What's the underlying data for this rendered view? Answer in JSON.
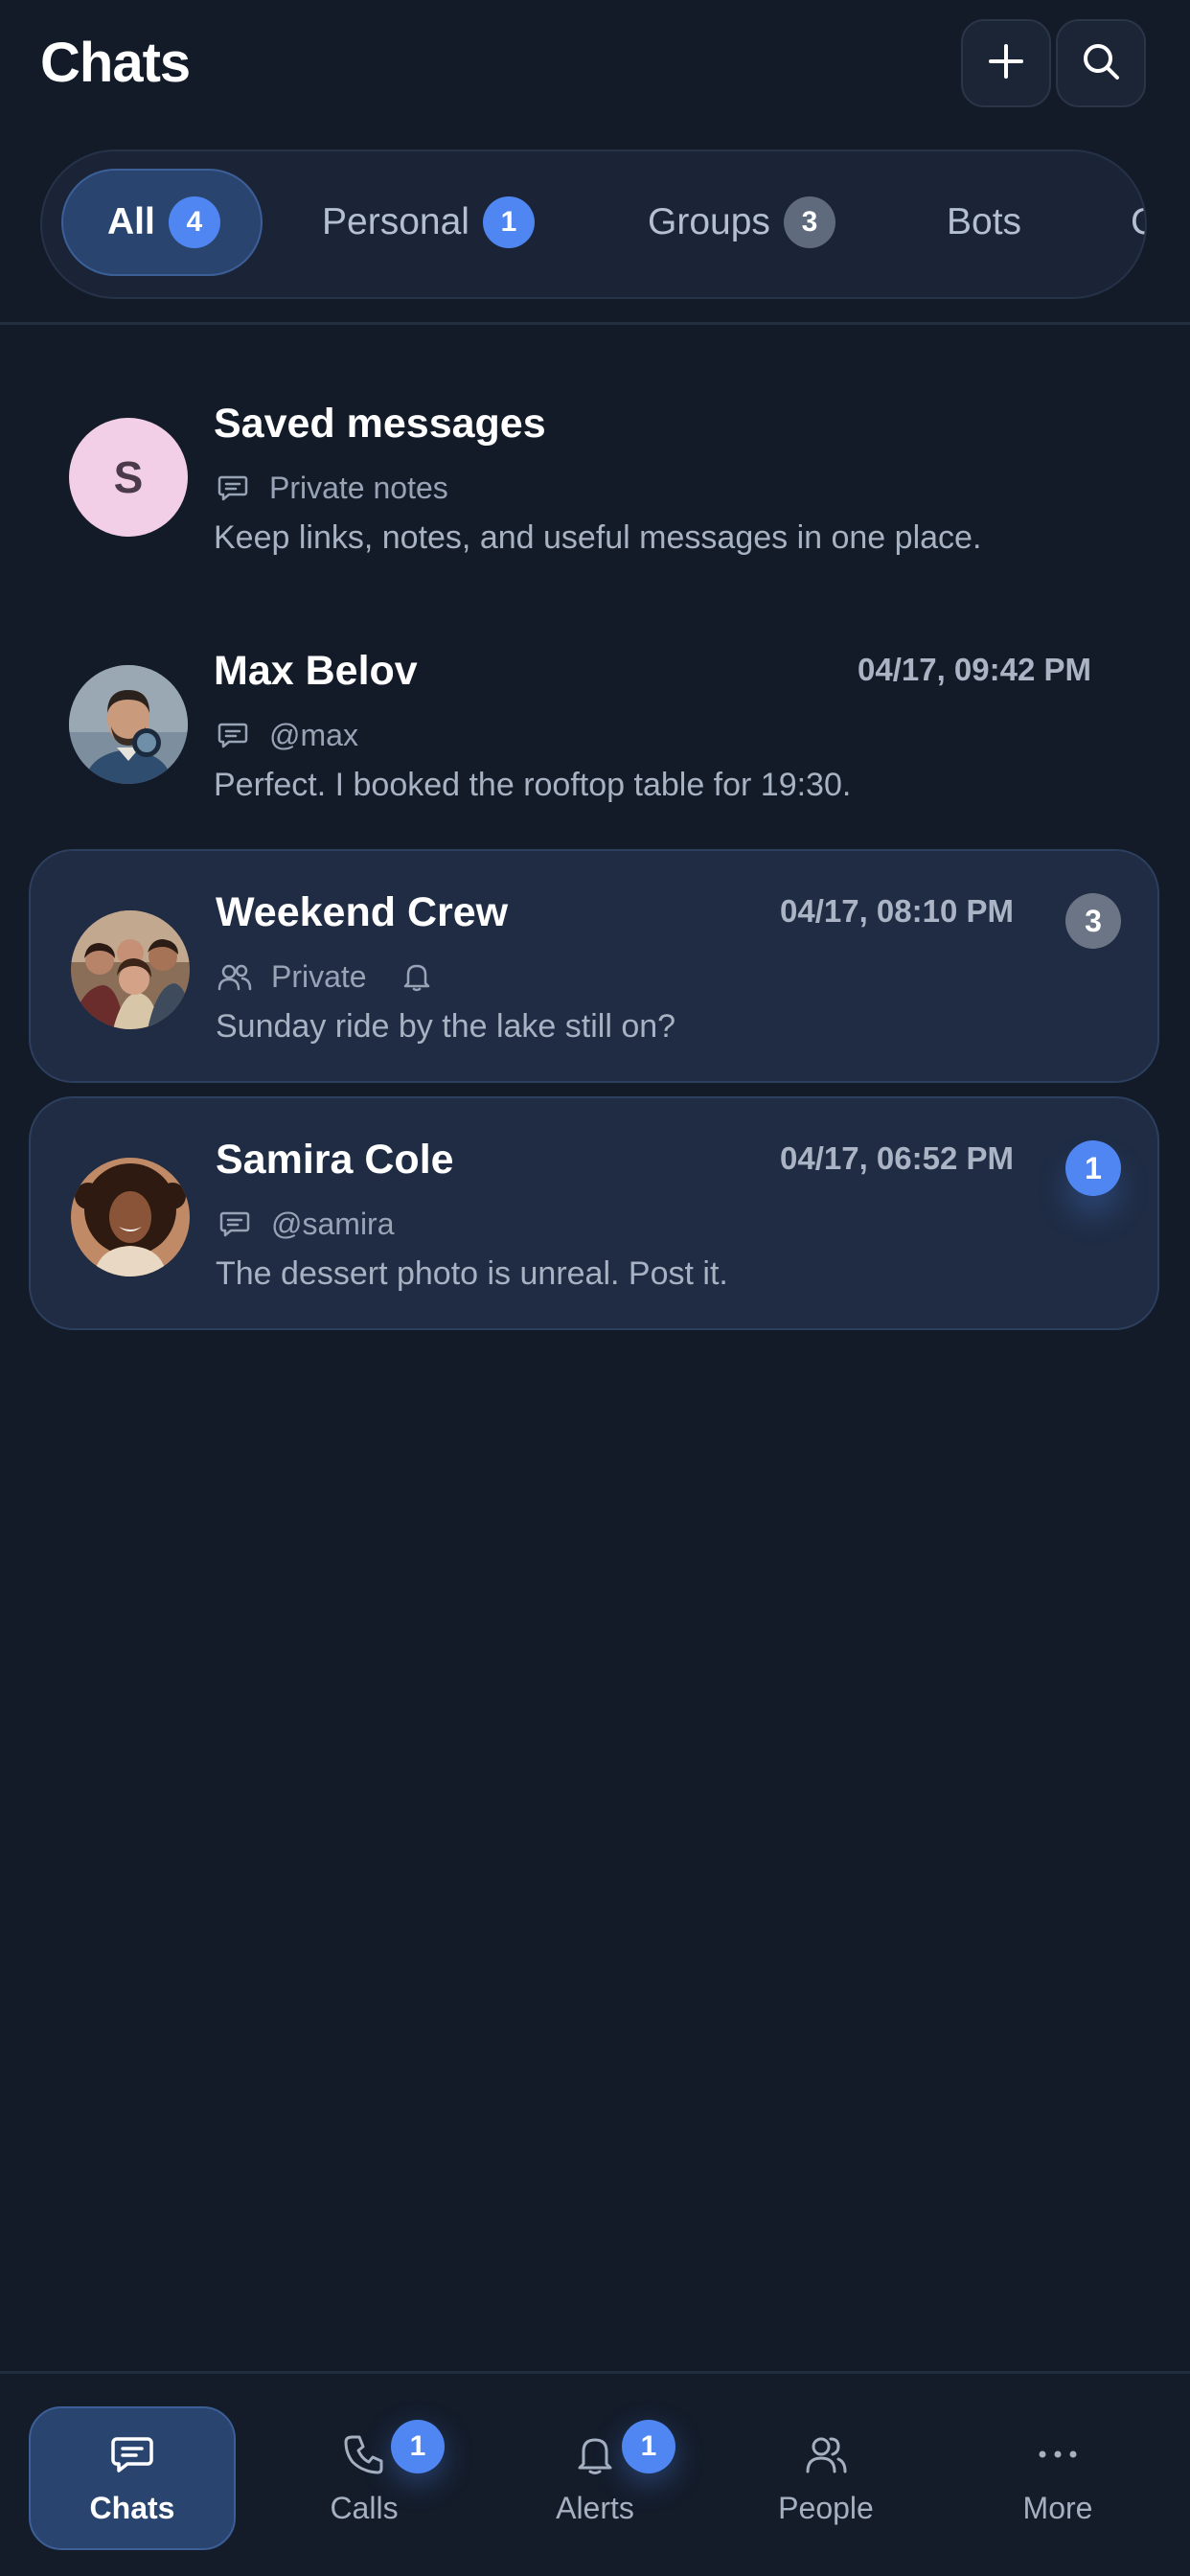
{
  "header": {
    "title": "Chats",
    "add_icon": "plus-icon",
    "search_icon": "search-icon"
  },
  "tabs": [
    {
      "label": "All",
      "count": "4",
      "active": true
    },
    {
      "label": "Personal",
      "count": "1"
    },
    {
      "label": "Groups",
      "count": "3"
    },
    {
      "label": "Bots"
    },
    {
      "label": "C"
    }
  ],
  "chats": [
    {
      "name": "Saved messages",
      "avatar_letter": "S",
      "meta_icon": "message-icon",
      "meta": "Private notes",
      "preview": "Keep links, notes, and useful messages in one place."
    },
    {
      "name": "Max Belov",
      "time": "04/17, 09:42 PM",
      "meta_icon": "message-icon",
      "meta": "@max",
      "preview": "Perfect. I booked the rooftop table for 19:30."
    },
    {
      "name": "Weekend Crew",
      "time": "04/17, 08:10 PM",
      "meta_icon": "group-icon",
      "meta": "Private",
      "muted_icon": "bell-icon",
      "preview": "Sunday ride by the lake still on?",
      "unread": "3"
    },
    {
      "name": "Samira Cole",
      "time": "04/17, 06:52 PM",
      "meta_icon": "message-icon",
      "meta": "@samira",
      "preview": "The dessert photo is unreal. Post it.",
      "unread": "1"
    }
  ],
  "nav": [
    {
      "label": "Chats",
      "icon": "chat-icon",
      "active": true
    },
    {
      "label": "Calls",
      "icon": "phone-icon",
      "badge": "1"
    },
    {
      "label": "Alerts",
      "icon": "bell-icon",
      "badge": "1"
    },
    {
      "label": "People",
      "icon": "people-icon"
    },
    {
      "label": "More",
      "icon": "more-icon"
    }
  ],
  "colors": {
    "background": "#131b29",
    "accent": "#4f86f2",
    "active_tab": "#2a4470",
    "highlight_row": "#1f2c44"
  }
}
